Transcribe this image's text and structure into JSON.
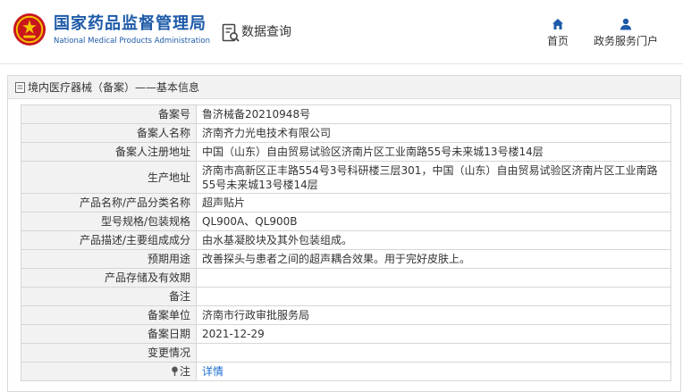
{
  "header": {
    "brand_cn": "国家药品监督管理局",
    "brand_en": "National Medical Products Administration",
    "query_label": "数据查询",
    "nav": [
      {
        "label": "首页",
        "icon": "home-icon"
      },
      {
        "label": "政务服务门户",
        "icon": "user-icon"
      }
    ],
    "accent_color": "#1e5aa8"
  },
  "breadcrumb": "境内医疗器械（备案）——基本信息",
  "rows": [
    {
      "label": "备案号",
      "value": "鲁济械备20210948号"
    },
    {
      "label": "备案人名称",
      "value": "济南齐力光电技术有限公司"
    },
    {
      "label": "备案人注册地址",
      "value": "中国（山东）自由贸易试验区济南片区工业南路55号未来城13号楼14层"
    },
    {
      "label": "生产地址",
      "value": "济南市高新区正丰路554号3号科研楼三层301，中国（山东）自由贸易试验区济南片区工业南路55号未来城13号楼14层"
    },
    {
      "label": "产品名称/产品分类名称",
      "value": "超声贴片"
    },
    {
      "label": "型号规格/包装规格",
      "value": "QL900A、QL900B"
    },
    {
      "label": "产品描述/主要组成成分",
      "value": "由水基凝胶块及其外包装组成。"
    },
    {
      "label": "预期用途",
      "value": "改善探头与患者之间的超声耦合效果。用于完好皮肤上。"
    },
    {
      "label": "产品存储及有效期",
      "value": ""
    },
    {
      "label": "备注",
      "value": ""
    },
    {
      "label": "备案单位",
      "value": "济南市行政审批服务局"
    },
    {
      "label": "备案日期",
      "value": "2021-12-29"
    },
    {
      "label": "变更情况",
      "value": ""
    }
  ],
  "note": {
    "label": "注",
    "link": "详情",
    "icon": "pin-icon"
  }
}
